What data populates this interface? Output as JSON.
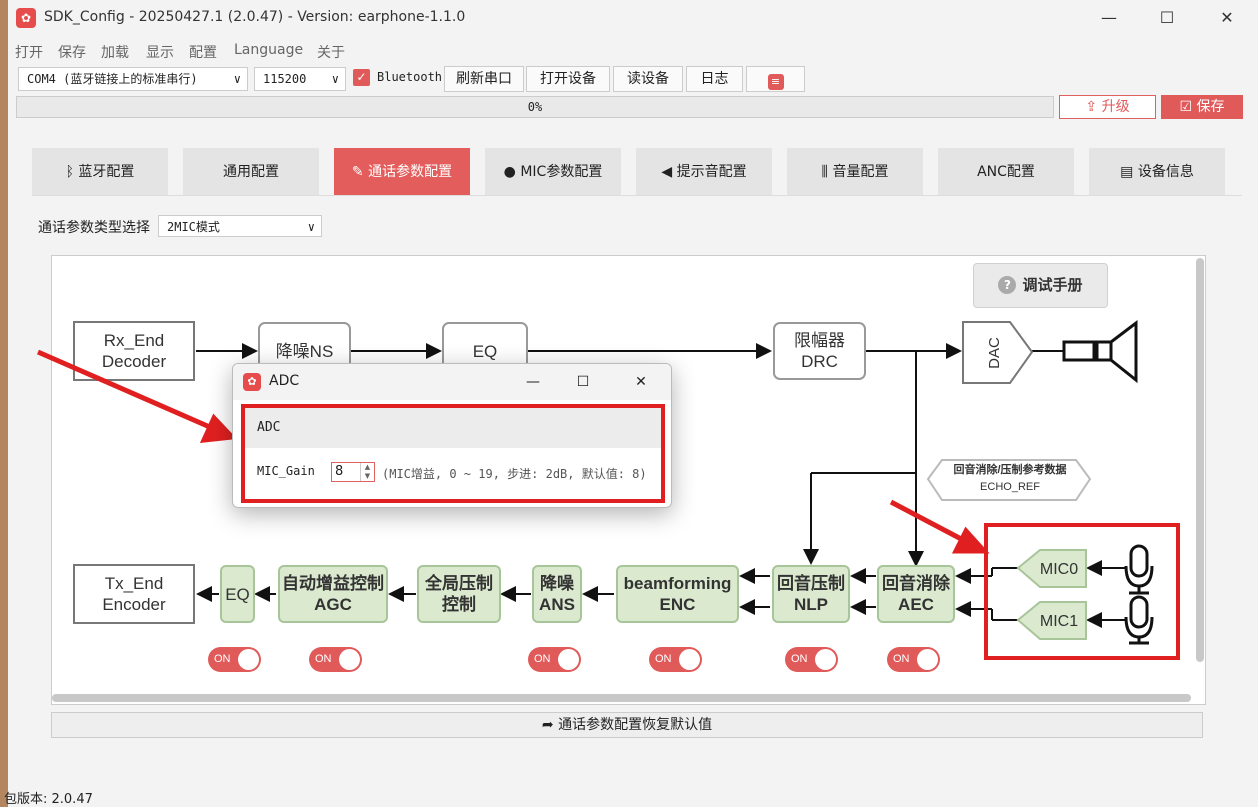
{
  "window": {
    "title": "SDK_Config -  20250427.1  (2.0.47) - Version: earphone-1.1.0",
    "min": "—",
    "max": "☐",
    "close": "✕"
  },
  "menu": [
    "打开",
    "保存",
    "加载",
    "显示",
    "配置",
    "Language",
    "关于"
  ],
  "toolbar": {
    "port": "COM4 (蓝牙链接上的标准串行)",
    "baud": "115200",
    "bluetooth_checked": true,
    "bluetooth_label": "Bluetooth",
    "refresh_port": "刷新串口",
    "open_device": "打开设备",
    "read_device": "读设备",
    "log": "日志",
    "settings_icon": "sliders-icon"
  },
  "progress": {
    "text": "0%",
    "value": 0
  },
  "actions": {
    "upgrade": "升级",
    "save": "保存"
  },
  "tabs": [
    {
      "label": "蓝牙配置",
      "icon": "bluetooth-icon"
    },
    {
      "label": "通用配置",
      "icon": ""
    },
    {
      "label": "通话参数配置",
      "icon": "doc-edit-icon",
      "active": true
    },
    {
      "label": "MIC参数配置",
      "icon": "mic-icon"
    },
    {
      "label": "提示音配置",
      "icon": "speaker-icon"
    },
    {
      "label": "音量配置",
      "icon": "waveform-icon"
    },
    {
      "label": "ANC配置",
      "icon": ""
    },
    {
      "label": "设备信息",
      "icon": "clipboard-icon"
    }
  ],
  "call_type": {
    "label": "通话参数类型选择",
    "value": "2MIC模式"
  },
  "manual_button": "调试手册",
  "diagram": {
    "rx_end": [
      "Rx_End",
      "Decoder"
    ],
    "ns": "降噪NS",
    "eq_top": "EQ",
    "drc": [
      "限幅器",
      "DRC"
    ],
    "dac": "DAC",
    "echo_ref": [
      "回音消除/压制参考数据",
      "ECHO_REF"
    ],
    "tx_end": [
      "Tx_End",
      "Encoder"
    ],
    "eq_bottom": "EQ",
    "agc": [
      "自动增益控制",
      "AGC"
    ],
    "global": [
      "全局压制",
      "控制"
    ],
    "ans": [
      "降噪",
      "ANS"
    ],
    "enc": [
      "beamforming",
      "ENC"
    ],
    "nlp": [
      "回音压制",
      "NLP"
    ],
    "aec": [
      "回音消除",
      "AEC"
    ],
    "mic0": "MIC0",
    "mic1": "MIC1",
    "toggles": [
      "ON",
      "ON",
      "ON",
      "ON",
      "ON",
      "ON"
    ]
  },
  "restore_button": "通话参数配置恢复默认值",
  "footer": "包版本: 2.0.47",
  "dialog": {
    "title": "ADC",
    "group": "ADC",
    "field_label": "MIC_Gain",
    "field_value": "8",
    "hint": "(MIC增益, 0 ~ 19, 步进: 2dB, 默认值: 8)"
  },
  "colors": {
    "accent": "#e05a5a",
    "green_block": "#dbeacf",
    "annotation_red": "#e02020"
  }
}
